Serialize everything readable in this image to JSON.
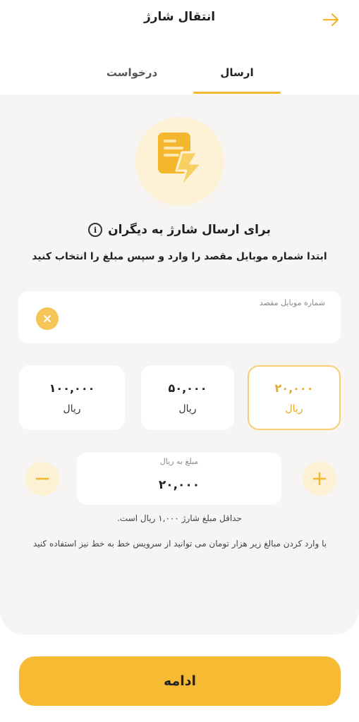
{
  "header": {
    "title": "انتقال شارژ",
    "back_icon": "arrow-right-icon"
  },
  "tabs": [
    {
      "label": "ارسال",
      "active": true
    },
    {
      "label": "درخواست",
      "active": false
    }
  ],
  "hero": {
    "icon": "charge-bolt-icon"
  },
  "heading": {
    "title": "برای ارسال شارژ به دیگران",
    "info_icon": "i"
  },
  "subheading": "ابتدا شماره موبایل مقصد را وارد و سپس مبلغ را انتخاب کنید",
  "phone": {
    "label": "شماره موبایل مقصد",
    "value": "",
    "clear_icon": "close-icon"
  },
  "amounts": [
    {
      "value": "۲۰,۰۰۰",
      "unit": "ریال",
      "selected": true
    },
    {
      "value": "۵۰,۰۰۰",
      "unit": "ریال",
      "selected": false
    },
    {
      "value": "۱۰۰,۰۰۰",
      "unit": "ریال",
      "selected": false
    }
  ],
  "amount_input": {
    "label": "مبلغ به ریال",
    "value": "۲۰,۰۰۰"
  },
  "notes": {
    "min_amount": "حداقل مبلغ شارژ ۱,۰۰۰ ریال است.",
    "service_note": "با وارد کردن مبالغ زیر هزار تومان می توانید از سرویس خط به خط نیز استفاده کنید"
  },
  "continue_label": "ادامه",
  "colors": {
    "accent": "#f6bb33",
    "accent_light": "#fdf1d3",
    "panel_bg": "#f6f5f3",
    "selected_text": "#e2a928"
  }
}
